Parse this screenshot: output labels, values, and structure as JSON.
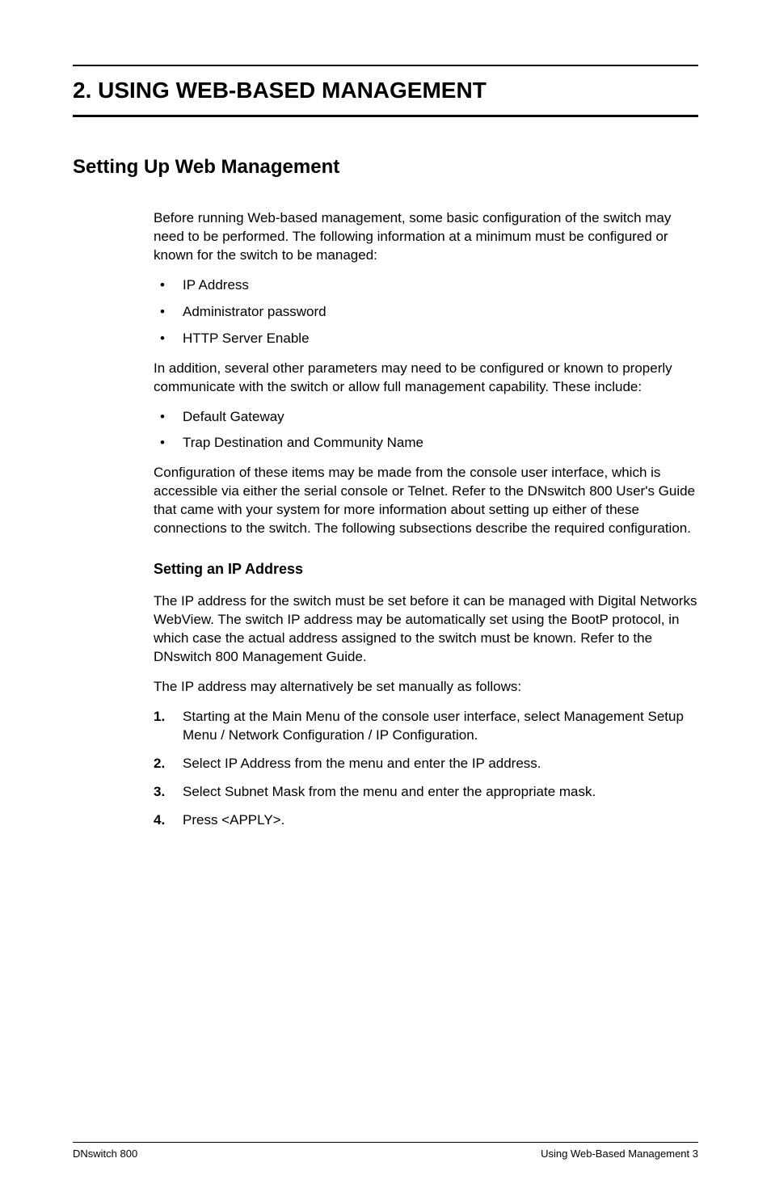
{
  "chapter": {
    "title": "2.  USING WEB-BASED MANAGEMENT"
  },
  "section": {
    "title": "Setting Up Web Management",
    "intro": "Before running Web-based management, some basic configuration of the switch may need to be performed. The following information at a minimum must be configured or known for the switch to be managed:",
    "minList": [
      "IP Address",
      "Administrator password",
      "HTTP Server Enable"
    ],
    "additional": "In addition, several other parameters may need to be configured or known to properly communicate with the switch or allow full management capability. These include:",
    "addList": [
      "Default Gateway",
      "Trap Destination and Community Name"
    ],
    "configNote": "Configuration of these items may be made from the console user interface, which is accessible via either the serial console or Telnet. Refer to the DNswitch 800 User's Guide that came with your system for more information about setting up either of these connections to the switch. The following subsections describe the required configuration."
  },
  "subsection": {
    "title": "Setting an IP Address",
    "para1": "The IP address for the switch must be set before it can be managed with Digital Networks WebView. The switch IP address may be automatically set using the BootP protocol, in which case the actual address assigned to the switch must be known. Refer to the DNswitch 800 Management Guide.",
    "para2": "The IP address may alternatively be set manually as follows:",
    "steps": [
      "Starting at the Main Menu of the console user interface, select Management Setup Menu / Network Configuration / IP Configuration.",
      "Select IP Address from the menu and enter the IP address.",
      "Select Subnet Mask from the menu and enter the appropriate mask.",
      "Press <APPLY>."
    ]
  },
  "footer": {
    "left": "DNswitch 800",
    "right": "Using Web-Based Management  3"
  }
}
